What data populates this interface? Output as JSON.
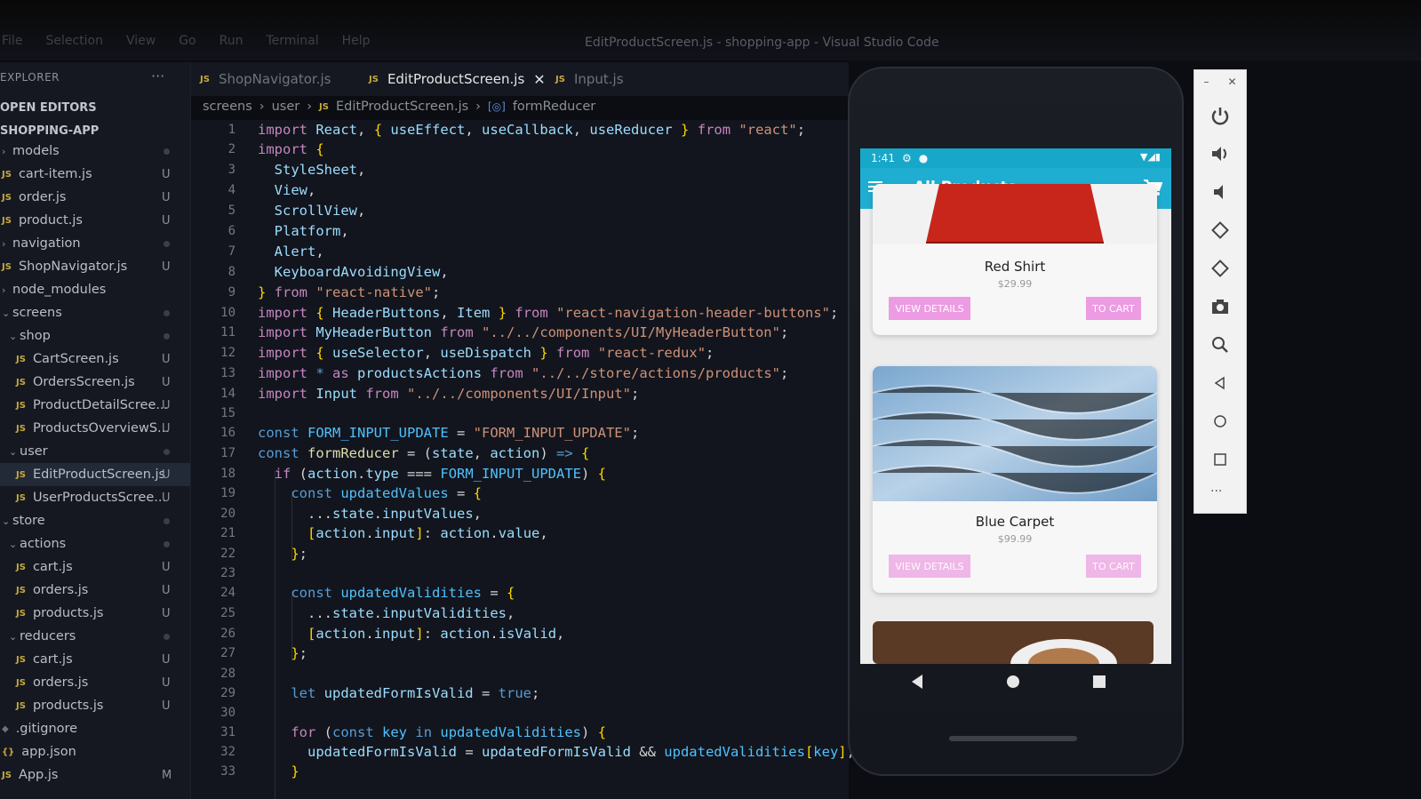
{
  "window": {
    "menu": [
      "File",
      "Selection",
      "View",
      "Go",
      "Run",
      "Terminal",
      "Help"
    ],
    "title": "EditProductScreen.js - shopping-app - Visual Studio Code"
  },
  "sidebar": {
    "header": "EXPLORER",
    "more": "···",
    "sections": [
      "OPEN EDITORS",
      "SHOPPING-APP"
    ],
    "items": [
      {
        "label": "models",
        "kind": "folder",
        "badge": ""
      },
      {
        "label": "cart-item.js",
        "kind": "js",
        "badge": "U"
      },
      {
        "label": "order.js",
        "kind": "js",
        "badge": "U"
      },
      {
        "label": "product.js",
        "kind": "js",
        "badge": "U"
      },
      {
        "label": "navigation",
        "kind": "folder",
        "badge": ""
      },
      {
        "label": "ShopNavigator.js",
        "kind": "js",
        "badge": "U"
      },
      {
        "label": "node_modules",
        "kind": "folder",
        "badge": ""
      },
      {
        "label": "screens",
        "kind": "folder",
        "badge": ""
      },
      {
        "label": "shop",
        "kind": "folder",
        "badge": ""
      },
      {
        "label": "CartScreen.js",
        "kind": "js",
        "badge": "U"
      },
      {
        "label": "OrdersScreen.js",
        "kind": "js",
        "badge": "U"
      },
      {
        "label": "ProductDetailScree...",
        "kind": "js",
        "badge": "U"
      },
      {
        "label": "ProductsOverviewS...",
        "kind": "js",
        "badge": "U"
      },
      {
        "label": "user",
        "kind": "folder",
        "badge": ""
      },
      {
        "label": "EditProductScreen.js",
        "kind": "js",
        "badge": "U"
      },
      {
        "label": "UserProductsScree...",
        "kind": "js",
        "badge": "U"
      },
      {
        "label": "store",
        "kind": "folder",
        "badge": ""
      },
      {
        "label": "actions",
        "kind": "folder",
        "badge": ""
      },
      {
        "label": "cart.js",
        "kind": "js",
        "badge": "U"
      },
      {
        "label": "orders.js",
        "kind": "js",
        "badge": "U"
      },
      {
        "label": "products.js",
        "kind": "js",
        "badge": "U"
      },
      {
        "label": "reducers",
        "kind": "folder",
        "badge": ""
      },
      {
        "label": "cart.js",
        "kind": "js",
        "badge": "U"
      },
      {
        "label": "orders.js",
        "kind": "js",
        "badge": "U"
      },
      {
        "label": "products.js",
        "kind": "js",
        "badge": "U"
      },
      {
        "label": ".gitignore",
        "kind": "file",
        "badge": ""
      },
      {
        "label": "app.json",
        "kind": "json",
        "badge": ""
      },
      {
        "label": "App.js",
        "kind": "js",
        "badge": "M"
      }
    ]
  },
  "tabs": [
    {
      "label": "ShopNavigator.js",
      "active": false
    },
    {
      "label": "EditProductScreen.js",
      "active": true
    },
    {
      "label": "Input.js",
      "active": false
    }
  ],
  "tab_close": "✕",
  "breadcrumb": [
    "screens",
    "user",
    "EditProductScreen.js",
    "formReducer"
  ],
  "code": {
    "line_numbers": [
      "1",
      "2",
      "3",
      "4",
      "5",
      "6",
      "7",
      "8",
      "9",
      "10",
      "11",
      "12",
      "13",
      "14",
      "15",
      "16",
      "17",
      "18",
      "19",
      "20",
      "21",
      "22",
      "23",
      "24",
      "25",
      "26",
      "27",
      "28",
      "29",
      "30",
      "31",
      "32",
      "33"
    ]
  },
  "phone": {
    "status_time": "1:41",
    "app_title": "All Products",
    "products": [
      {
        "name": "Red Shirt",
        "price": "$29.99",
        "details_label": "VIEW DETAILS",
        "cart_label": "TO CART"
      },
      {
        "name": "Blue Carpet",
        "price": "$99.99",
        "details_label": "VIEW DETAILS",
        "cart_label": "TO CART"
      }
    ]
  },
  "emulator": {
    "top_controls": [
      "–",
      "✕"
    ],
    "more": "···"
  },
  "colors": {
    "app_bar": "#1faed1",
    "button_pink": "#ed9be3",
    "js_badge": "#c8a941"
  }
}
